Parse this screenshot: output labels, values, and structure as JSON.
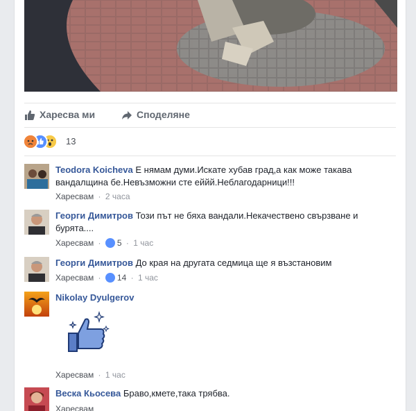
{
  "actions": {
    "like_label": "Харесва ми",
    "share_label": "Споделяне"
  },
  "reactions": {
    "count": "13",
    "icons": [
      "angry-icon",
      "like-icon",
      "wow-icon"
    ]
  },
  "comments": [
    {
      "author": "Teodora Koicheva",
      "text": "Е нямам думи.Искате хубав град,а как може такава вандалщина бе.Невъзможни сте еййй.Неблагодарници!!!",
      "like_label": "Харесвам",
      "time": "2 часа",
      "likes": ""
    },
    {
      "author": "Георги Димитров",
      "text": "Този път не бяха вандали.Некачествено свързване и бурята....",
      "like_label": "Харесвам",
      "time": "1 час",
      "likes": "5"
    },
    {
      "author": "Георги Димитров",
      "text": "До края на другата седмица ще я възстановим",
      "like_label": "Харесвам",
      "time": "1 час",
      "likes": "14"
    },
    {
      "author": "Nikolay Dyulgerov",
      "text": "",
      "like_label": "Харесвам",
      "time": "1 час",
      "likes": "",
      "sticker": "thumbs-up-sticker"
    },
    {
      "author": "Веска Кьосева",
      "text": "Браво,кмете,така трябва.",
      "like_label": "Харесвам",
      "time": "",
      "likes": ""
    }
  ],
  "separator": "·",
  "colors": {
    "link": "#365899",
    "like_blue": "#5890ff",
    "meta_gray": "#90949c"
  }
}
